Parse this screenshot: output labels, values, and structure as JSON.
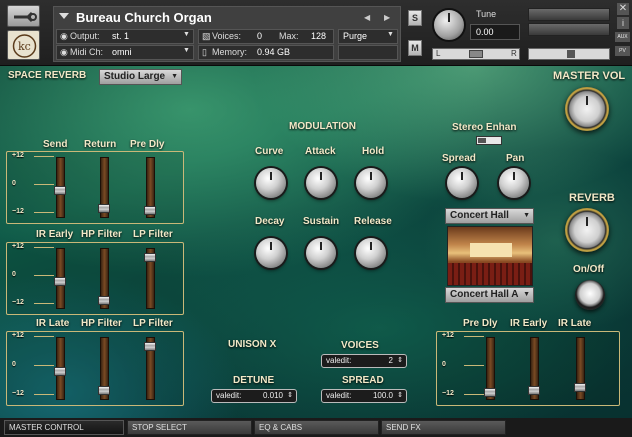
{
  "header": {
    "instrument_name": "Bureau Church Organ",
    "output_label": "Output:",
    "output_value": "st. 1",
    "midi_label": "Midi Ch:",
    "midi_value": "omni",
    "voices_label": "Voices:",
    "voices_value": "0",
    "max_label": "Max:",
    "max_value": "128",
    "memory_label": "Memory:",
    "memory_value": "0.94 GB",
    "purge_label": "Purge",
    "solo_label": "S",
    "mute_label": "M",
    "tune_label": "Tune",
    "tune_value": "0.00",
    "pan_left": "L",
    "pan_right": "R",
    "aux_label": "AUX",
    "pv_label": "PV",
    "icons": [
      "wrench-icon",
      "logo-icon",
      "close-icon",
      "info-icon",
      "camera-icon"
    ]
  },
  "space_reverb": {
    "label": "SPACE REVERB",
    "preset": "Studio Large"
  },
  "panel1": {
    "labels": [
      "Send",
      "Return",
      "Pre Dly"
    ],
    "levels": [
      0.45,
      0.1,
      0.05
    ]
  },
  "panel2": {
    "labels": [
      "IR Early",
      "HP Filter",
      "LP Filter"
    ],
    "levels": [
      0.45,
      0.08,
      0.9
    ]
  },
  "panel3": {
    "labels": [
      "IR Late",
      "HP Filter",
      "LP Filter"
    ],
    "levels": [
      0.45,
      0.1,
      0.9
    ]
  },
  "panel4": {
    "labels": [
      "Pre Dly",
      "IR Early",
      "IR Late"
    ],
    "levels": [
      0.05,
      0.1,
      0.15
    ]
  },
  "scale": {
    "top": "+12",
    "mid": "0",
    "bottom": "−12"
  },
  "modulation": {
    "title": "MODULATION",
    "knobs": [
      "Curve",
      "Attack",
      "Hold",
      "Decay",
      "Sustain",
      "Release"
    ]
  },
  "stereo": {
    "label": "Stereo Enhan",
    "spread": "Spread",
    "pan": "Pan"
  },
  "hall": {
    "top_preset": "Concert Hall",
    "bottom_preset": "Concert Hall A"
  },
  "master_vol": {
    "label": "MASTER VOL"
  },
  "reverb": {
    "label": "REVERB",
    "onoff": "On/Off"
  },
  "unison": {
    "label": "UNISON X",
    "voices_label": "VOICES",
    "voices_param": "valedit:",
    "voices_value": "2",
    "detune_label": "DETUNE",
    "detune_param": "valedit:",
    "detune_value": "0.010",
    "spread_label": "SPREAD",
    "spread_param": "valedit:",
    "spread_value": "100.0"
  },
  "tabs": [
    "MASTER CONTROL",
    "STOP SELECT",
    "EQ & CABS",
    "SEND FX"
  ],
  "colors": {
    "accent_text": "#f2e9c8",
    "panel_border": "#c9b878",
    "background": "#0f5a48"
  }
}
